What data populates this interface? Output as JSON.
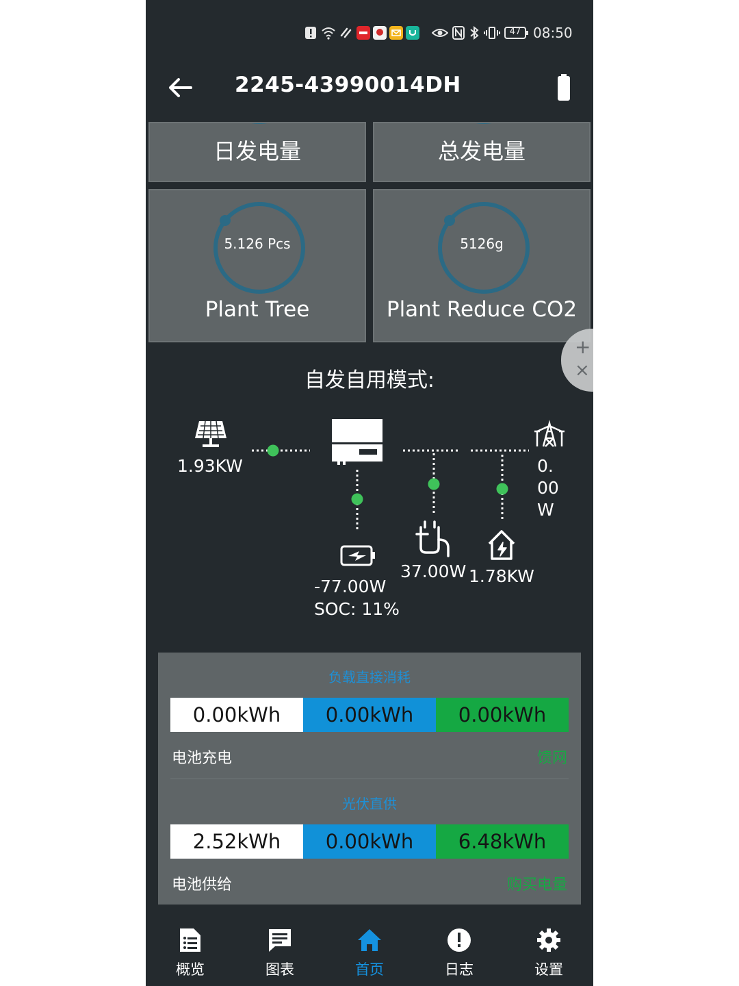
{
  "status_bar": {
    "time": "08:50",
    "battery_level": "47"
  },
  "header": {
    "title": "2245-43990014DH"
  },
  "tiles": {
    "daily_generation": "日发电量",
    "total_generation": "总发电量",
    "plant_tree": {
      "value": "5.126 Pcs",
      "label": "Plant Tree"
    },
    "reduce_co2": {
      "value": "5126g",
      "label": "Plant Reduce CO2"
    }
  },
  "float_widget": {
    "plus": "+",
    "close": "×"
  },
  "mode": {
    "title": "自发自用模式:"
  },
  "flow": {
    "pv_power": "1.93KW",
    "grid_power_lines": [
      "0.",
      "00",
      "W"
    ],
    "battery_power": "-77.00W",
    "battery_soc": "SOC: 11%",
    "eps_power": "37.00W",
    "home_power": "1.78KW"
  },
  "stats": {
    "section1": {
      "heading": "负载直接消耗",
      "values": [
        "0.00kWh",
        "0.00kWh",
        "0.00kWh"
      ],
      "left_label": "电池充电",
      "right_label": "馈网"
    },
    "section2": {
      "heading": "光伏直供",
      "values": [
        "2.52kWh",
        "0.00kWh",
        "6.48kWh"
      ],
      "left_label": "电池供给",
      "right_label": "购买电量"
    }
  },
  "nav": {
    "items": [
      {
        "label": "概览",
        "icon": "overview-icon"
      },
      {
        "label": "图表",
        "icon": "chart-icon"
      },
      {
        "label": "首页",
        "icon": "home-icon",
        "active": true
      },
      {
        "label": "日志",
        "icon": "log-icon"
      },
      {
        "label": "设置",
        "icon": "settings-icon"
      }
    ]
  },
  "colors": {
    "background": "#242a2e",
    "tile": "#5f6567",
    "accent_blue": "#1191d8",
    "accent_green": "#15a843",
    "flow_dot": "#3fc25a"
  }
}
